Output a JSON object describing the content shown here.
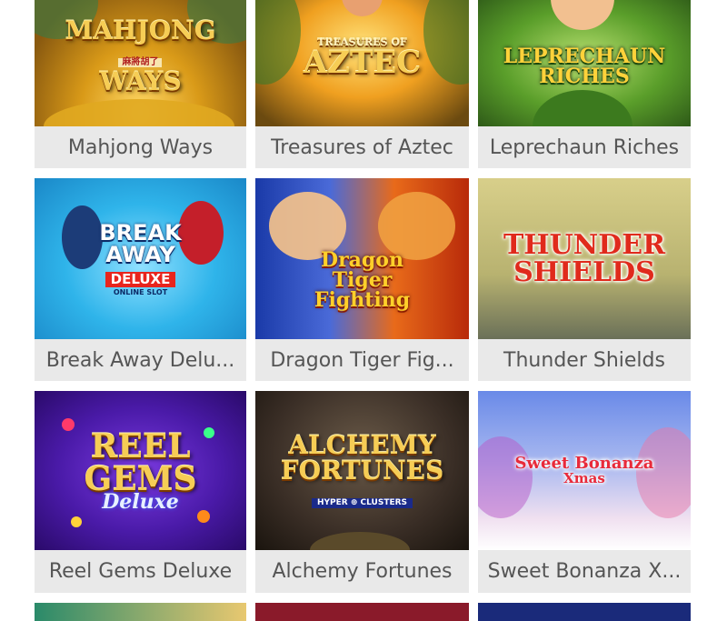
{
  "games": [
    {
      "id": "mahjong",
      "caption": "Mahjong Ways",
      "art_lines": [
        "Mahjong",
        "麻將胡了",
        "Ways"
      ]
    },
    {
      "id": "aztec",
      "caption": "Treasures of Aztec",
      "art_lines": [
        "Treasures of",
        "Aztec"
      ]
    },
    {
      "id": "leprechaun",
      "caption": "Leprechaun Riches",
      "art_lines": [
        "Leprechaun",
        "Riches"
      ]
    },
    {
      "id": "breakaway",
      "caption": "Break Away Delu...",
      "art_lines": [
        "Break",
        "Away",
        "Deluxe",
        "Online Slot"
      ]
    },
    {
      "id": "dragon",
      "caption": "Dragon Tiger Fig...",
      "art_lines": [
        "Dragon",
        "Tiger",
        "Fighting"
      ]
    },
    {
      "id": "thunder",
      "caption": "Thunder Shields",
      "art_lines": [
        "Thunder",
        "Shields"
      ]
    },
    {
      "id": "reelgems",
      "caption": "Reel Gems Deluxe",
      "art_lines": [
        "Reel",
        "Gems",
        "Deluxe"
      ]
    },
    {
      "id": "alchemy",
      "caption": "Alchemy Fortunes",
      "art_lines": [
        "Alchemy",
        "Fortunes",
        "Hyper",
        "Clusters"
      ]
    },
    {
      "id": "bonanza",
      "caption": "Sweet Bonanza X...",
      "art_lines": [
        "Sweet Bonanza",
        "Xmas"
      ]
    }
  ],
  "colors": {
    "caption_bg": "#e9e9e9",
    "caption_text": "#555555",
    "page_bg": "#ffffff"
  }
}
